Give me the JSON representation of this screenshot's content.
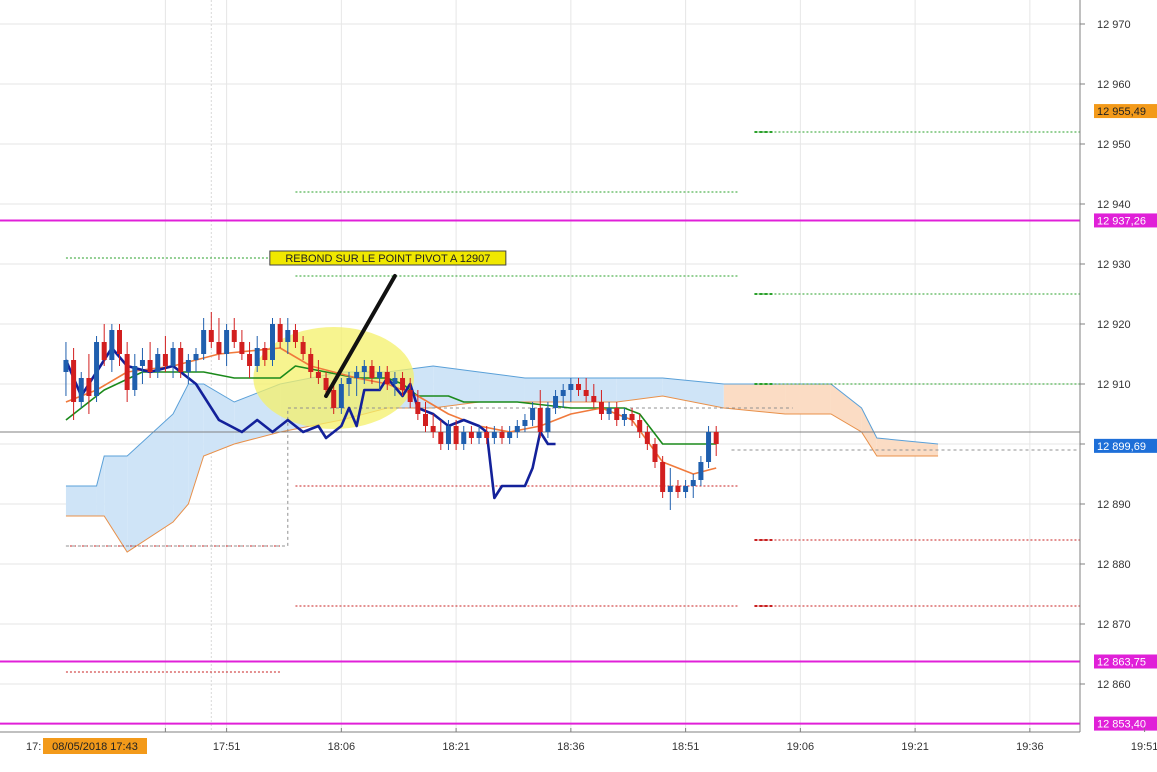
{
  "chart_data": {
    "type": "candlestick",
    "colors": {
      "up": "#1f5fae",
      "down": "#d21f1f",
      "pivot_line": "#e020d8",
      "r_levels": "#2aa02a",
      "s_levels": "#c82020",
      "kijun": "#1b8a1b",
      "tenkan": "#f07a3c",
      "chikou": "#13219a",
      "cloud_bull": "#cfe4f7",
      "cloud_bear": "#fbdcc4",
      "highlight": "#f4f06a",
      "label_orange": "#f39a1a",
      "label_magenta": "#e020d8",
      "label_blue": "#1e6fd8"
    },
    "y_axis": {
      "ticks": [
        "12 970",
        "12 960",
        "12 950",
        "12 940",
        "12 930",
        "12 920",
        "12 910",
        "12 900",
        "12 890",
        "12 880",
        "12 870",
        "12 860"
      ],
      "range": [
        12852,
        12974
      ]
    },
    "x_axis": {
      "ticks": [
        "17:51",
        "18:06",
        "18:21",
        "18:36",
        "18:51",
        "19:06",
        "19:21",
        "19:36",
        "19:51"
      ],
      "cursor_label": "08/05/2018 17:43",
      "cursor_left_text": "17:"
    },
    "price_labels": [
      {
        "text": "12 955,49",
        "value": 12955.49,
        "style": "orange"
      },
      {
        "text": "12 937,26",
        "value": 12937.26,
        "style": "magenta"
      },
      {
        "text": "12 899,69",
        "value": 12899.69,
        "style": "blue"
      },
      {
        "text": "12 863,75",
        "value": 12863.75,
        "style": "magenta"
      },
      {
        "text": "12 853,40",
        "value": 12853.4,
        "style": "magenta"
      }
    ],
    "pivot_lines": [
      12937.26,
      12863.75,
      12853.4
    ],
    "current_price": 12902,
    "annotation": {
      "text": "REBOND SUR LE POINT PIVOT A 12907",
      "arrow_from": [
        "18:13",
        12928
      ],
      "arrow_to": [
        "18:04",
        12908
      ]
    },
    "highlight": {
      "center": [
        "18:05",
        12911
      ],
      "width_min": 21,
      "height": 17
    },
    "pivot_levels": {
      "day1": {
        "from": "17:30",
        "to": "17:58",
        "r": [
          12931
        ],
        "s": [
          12883,
          12862
        ]
      },
      "day2": {
        "from": "18:00",
        "to": "18:58",
        "r": [
          12942,
          12928
        ],
        "s": [
          12893,
          12873
        ]
      },
      "day3": {
        "from": "19:00",
        "to": "19:51",
        "r": [
          12952,
          12925,
          12910
        ],
        "s": [
          12884,
          12873
        ]
      }
    },
    "candles": [
      [
        "17:30",
        12912,
        12917,
        12908,
        12914
      ],
      [
        "17:31",
        12914,
        12916,
        12904,
        12907
      ],
      [
        "17:32",
        12907,
        12912,
        12906,
        12911
      ],
      [
        "17:33",
        12911,
        12915,
        12905,
        12908
      ],
      [
        "17:34",
        12908,
        12918,
        12907,
        12917
      ],
      [
        "17:35",
        12917,
        12920,
        12913,
        12914
      ],
      [
        "17:36",
        12914,
        12920,
        12912,
        12919
      ],
      [
        "17:37",
        12919,
        12920,
        12913,
        12915
      ],
      [
        "17:38",
        12915,
        12917,
        12907,
        12909
      ],
      [
        "17:39",
        12909,
        12915,
        12908,
        12913
      ],
      [
        "17:40",
        12913,
        12916,
        12910,
        12914
      ],
      [
        "17:41",
        12914,
        12917,
        12911,
        12912
      ],
      [
        "17:42",
        12912,
        12916,
        12911,
        12915
      ],
      [
        "17:43",
        12915,
        12918,
        12912,
        12913
      ],
      [
        "17:44",
        12913,
        12917,
        12911,
        12916
      ],
      [
        "17:45",
        12916,
        12917,
        12911,
        12912
      ],
      [
        "17:46",
        12912,
        12915,
        12910,
        12914
      ],
      [
        "17:47",
        12914,
        12916,
        12912,
        12915
      ],
      [
        "17:48",
        12915,
        12921,
        12914,
        12919
      ],
      [
        "17:49",
        12919,
        12922,
        12916,
        12917
      ],
      [
        "17:50",
        12917,
        12921,
        12914,
        12915
      ],
      [
        "17:51",
        12915,
        12920,
        12913,
        12919
      ],
      [
        "17:52",
        12919,
        12921,
        12916,
        12917
      ],
      [
        "17:53",
        12917,
        12919,
        12914,
        12915
      ],
      [
        "17:54",
        12915,
        12917,
        12911,
        12913
      ],
      [
        "17:55",
        12913,
        12918,
        12912,
        12916
      ],
      [
        "17:56",
        12916,
        12917,
        12913,
        12914
      ],
      [
        "17:57",
        12914,
        12921,
        12913,
        12920
      ],
      [
        "17:58",
        12920,
        12921,
        12916,
        12917
      ],
      [
        "17:59",
        12917,
        12921,
        12915,
        12919
      ],
      [
        "18:00",
        12919,
        12920,
        12916,
        12917
      ],
      [
        "18:01",
        12917,
        12918,
        12914,
        12915
      ],
      [
        "18:02",
        12915,
        12916,
        12911,
        12912
      ],
      [
        "18:03",
        12912,
        12914,
        12910,
        12911
      ],
      [
        "18:04",
        12911,
        12912,
        12908,
        12909
      ],
      [
        "18:05",
        12909,
        12910,
        12905,
        12906
      ],
      [
        "18:06",
        12906,
        12911,
        12905,
        12910
      ],
      [
        "18:07",
        12910,
        12912,
        12908,
        12911
      ],
      [
        "18:08",
        12911,
        12913,
        12908,
        12912
      ],
      [
        "18:09",
        12912,
        12914,
        12910,
        12913
      ],
      [
        "18:10",
        12913,
        12914,
        12910,
        12911
      ],
      [
        "18:11",
        12911,
        12913,
        12909,
        12912
      ],
      [
        "18:12",
        12912,
        12913,
        12909,
        12910
      ],
      [
        "18:13",
        12910,
        12912,
        12908,
        12911
      ],
      [
        "18:14",
        12911,
        12912,
        12908,
        12909
      ],
      [
        "18:15",
        12909,
        12911,
        12906,
        12907
      ],
      [
        "18:16",
        12907,
        12909,
        12904,
        12905
      ],
      [
        "18:17",
        12905,
        12907,
        12902,
        12903
      ],
      [
        "18:18",
        12903,
        12905,
        12901,
        12902
      ],
      [
        "18:19",
        12902,
        12904,
        12899,
        12900
      ],
      [
        "18:20",
        12900,
        12904,
        12899,
        12903
      ],
      [
        "18:21",
        12903,
        12904,
        12899,
        12900
      ],
      [
        "18:22",
        12900,
        12903,
        12899,
        12902
      ],
      [
        "18:23",
        12902,
        12903,
        12900,
        12901
      ],
      [
        "18:24",
        12901,
        12903,
        12900,
        12902
      ],
      [
        "18:25",
        12902,
        12903,
        12900,
        12901
      ],
      [
        "18:26",
        12901,
        12903,
        12900,
        12902
      ],
      [
        "18:27",
        12902,
        12903,
        12900,
        12901
      ],
      [
        "18:28",
        12901,
        12903,
        12900,
        12902
      ],
      [
        "18:29",
        12902,
        12904,
        12901,
        12903
      ],
      [
        "18:30",
        12903,
        12905,
        12902,
        12904
      ],
      [
        "18:31",
        12904,
        12907,
        12903,
        12906
      ],
      [
        "18:32",
        12906,
        12909,
        12901,
        12902
      ],
      [
        "18:33",
        12902,
        12907,
        12901,
        12906
      ],
      [
        "18:34",
        12906,
        12909,
        12905,
        12908
      ],
      [
        "18:35",
        12908,
        12910,
        12906,
        12909
      ],
      [
        "18:36",
        12909,
        12911,
        12907,
        12910
      ],
      [
        "18:37",
        12910,
        12911,
        12908,
        12909
      ],
      [
        "18:38",
        12909,
        12911,
        12907,
        12908
      ],
      [
        "18:39",
        12908,
        12910,
        12906,
        12907
      ],
      [
        "18:40",
        12907,
        12909,
        12904,
        12905
      ],
      [
        "18:41",
        12905,
        12907,
        12904,
        12906
      ],
      [
        "18:42",
        12906,
        12907,
        12903,
        12904
      ],
      [
        "18:43",
        12904,
        12906,
        12903,
        12905
      ],
      [
        "18:44",
        12905,
        12906,
        12903,
        12904
      ],
      [
        "18:45",
        12904,
        12905,
        12901,
        12902
      ],
      [
        "18:46",
        12902,
        12903,
        12899,
        12900
      ],
      [
        "18:47",
        12900,
        12901,
        12896,
        12897
      ],
      [
        "18:48",
        12897,
        12898,
        12891,
        12892
      ],
      [
        "18:49",
        12892,
        12896,
        12889,
        12893
      ],
      [
        "18:50",
        12893,
        12894,
        12891,
        12892
      ],
      [
        "18:51",
        12892,
        12894,
        12891,
        12893
      ],
      [
        "18:52",
        12893,
        12895,
        12891,
        12894
      ],
      [
        "18:53",
        12894,
        12898,
        12893,
        12897
      ],
      [
        "18:54",
        12897,
        12903,
        12896,
        12902
      ],
      [
        "18:55",
        12902,
        12903,
        12898,
        12900
      ]
    ],
    "kijun": [
      [
        "17:30",
        12904
      ],
      [
        "17:35",
        12909
      ],
      [
        "17:40",
        12912
      ],
      [
        "17:48",
        12912
      ],
      [
        "17:52",
        12911
      ],
      [
        "17:58",
        12911
      ],
      [
        "18:00",
        12913
      ],
      [
        "18:08",
        12911
      ],
      [
        "18:12",
        12911
      ],
      [
        "18:14",
        12910
      ],
      [
        "18:16",
        12908
      ],
      [
        "18:20",
        12908
      ],
      [
        "18:22",
        12907
      ],
      [
        "18:29",
        12907
      ],
      [
        "18:36",
        12906
      ],
      [
        "18:43",
        12906
      ],
      [
        "18:45",
        12905
      ],
      [
        "18:48",
        12900
      ],
      [
        "18:55",
        12900
      ]
    ],
    "tenkan": [
      [
        "17:30",
        12907
      ],
      [
        "17:34",
        12909
      ],
      [
        "17:38",
        12912
      ],
      [
        "17:44",
        12913
      ],
      [
        "17:50",
        12915
      ],
      [
        "17:58",
        12916
      ],
      [
        "18:02",
        12913
      ],
      [
        "18:05",
        12912
      ],
      [
        "18:08",
        12911
      ],
      [
        "18:12",
        12910
      ],
      [
        "18:16",
        12908
      ],
      [
        "18:20",
        12905
      ],
      [
        "18:24",
        12903
      ],
      [
        "18:28",
        12902
      ],
      [
        "18:32",
        12903
      ],
      [
        "18:36",
        12905
      ],
      [
        "18:40",
        12906
      ],
      [
        "18:44",
        12904
      ],
      [
        "18:48",
        12897
      ],
      [
        "18:52",
        12895
      ],
      [
        "18:55",
        12896
      ]
    ],
    "chikou": [
      [
        "17:30",
        12914
      ],
      [
        "17:32",
        12908
      ],
      [
        "17:34",
        12912
      ],
      [
        "17:36",
        12916
      ],
      [
        "17:38",
        12913
      ],
      [
        "17:41",
        12912
      ],
      [
        "17:44",
        12913
      ],
      [
        "17:47",
        12910
      ],
      [
        "17:50",
        12904
      ],
      [
        "17:53",
        12902
      ],
      [
        "17:55",
        12904
      ],
      [
        "17:57",
        12902
      ],
      [
        "17:59",
        12904
      ],
      [
        "18:01",
        12902
      ],
      [
        "18:03",
        12903
      ],
      [
        "18:04",
        12901
      ],
      [
        "18:06",
        12903
      ],
      [
        "18:07",
        12906
      ],
      [
        "18:08",
        12903
      ],
      [
        "18:09",
        12909
      ],
      [
        "18:11",
        12909
      ],
      [
        "18:12",
        12911
      ],
      [
        "18:14",
        12908
      ],
      [
        "18:15",
        12910
      ],
      [
        "18:16",
        12906
      ],
      [
        "18:18",
        12905
      ],
      [
        "18:20",
        12903
      ],
      [
        "18:22",
        12904
      ],
      [
        "18:24",
        12903
      ],
      [
        "18:25",
        12902
      ],
      [
        "18:26",
        12891
      ],
      [
        "18:27",
        12893
      ],
      [
        "18:30",
        12893
      ],
      [
        "18:31",
        12896
      ],
      [
        "18:32",
        12902
      ],
      [
        "18:33",
        12900
      ],
      [
        "18:34",
        12900
      ]
    ],
    "cloud": [
      [
        "17:30",
        12893,
        12888
      ],
      [
        "17:34",
        12893,
        12888
      ],
      [
        "17:35",
        12898,
        12888
      ],
      [
        "17:38",
        12898,
        12882
      ],
      [
        "17:44",
        12905,
        12887
      ],
      [
        "17:46",
        12910,
        12890
      ],
      [
        "17:48",
        12910,
        12898
      ],
      [
        "17:52",
        12907,
        12900
      ],
      [
        "17:58",
        12910,
        12902
      ],
      [
        "18:06",
        12912,
        12904
      ],
      [
        "18:12",
        12912,
        12906
      ],
      [
        "18:18",
        12913,
        12906
      ],
      [
        "18:24",
        12912,
        12907
      ],
      [
        "18:30",
        12911,
        12907
      ],
      [
        "18:36",
        12911,
        12907
      ],
      [
        "18:42",
        12911,
        12907
      ],
      [
        "18:48",
        12911,
        12908
      ],
      [
        "18:56",
        12910,
        12906
      ],
      [
        "19:04",
        12910,
        12905
      ],
      [
        "19:10",
        12910,
        12905
      ],
      [
        "19:14",
        12906,
        12902
      ],
      [
        "19:16",
        12901,
        12898
      ],
      [
        "19:24",
        12900,
        12898
      ]
    ]
  }
}
